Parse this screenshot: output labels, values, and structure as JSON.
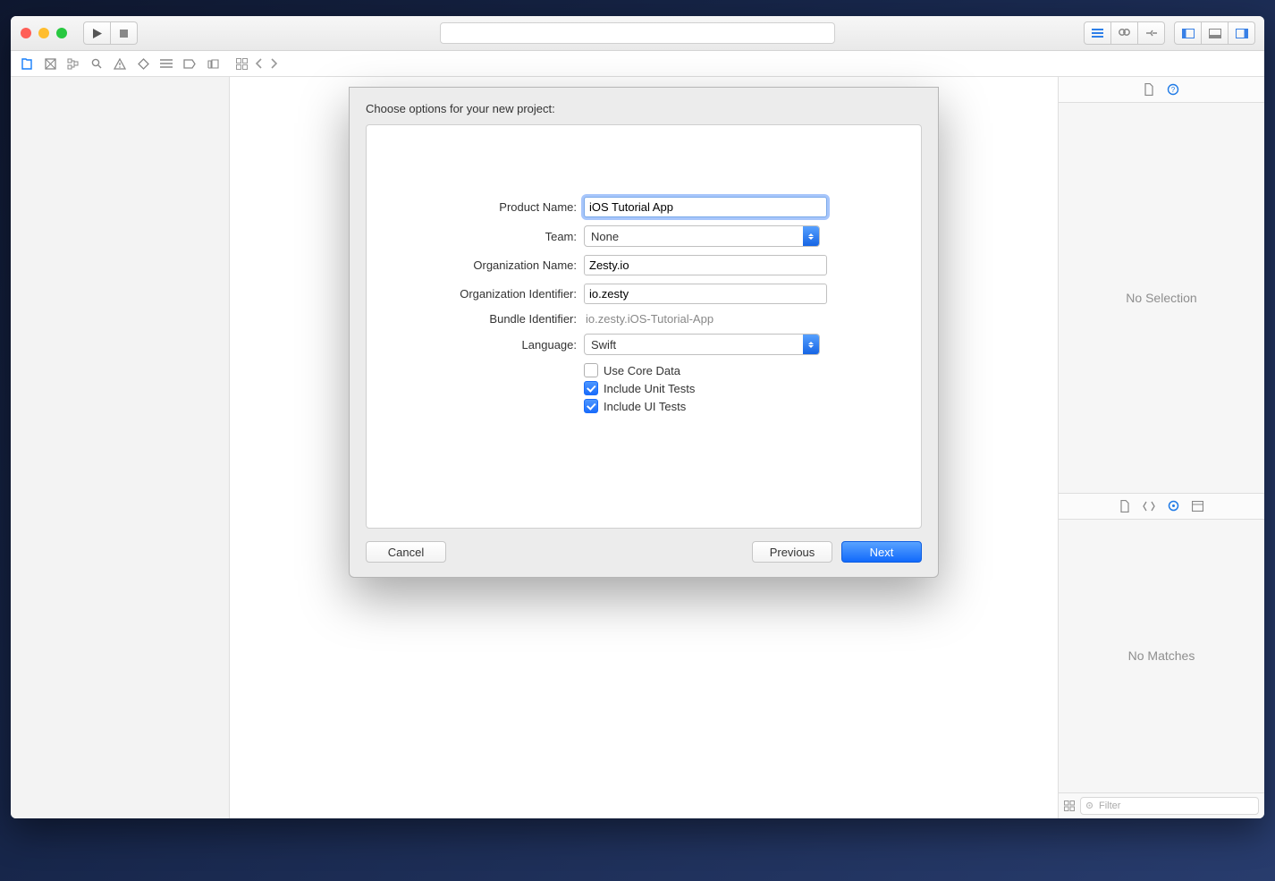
{
  "dialog": {
    "heading": "Choose options for your new project:",
    "fields": {
      "product_name": {
        "label": "Product Name:",
        "value": "iOS Tutorial App"
      },
      "team": {
        "label": "Team:",
        "value": "None"
      },
      "org_name": {
        "label": "Organization Name:",
        "value": "Zesty.io"
      },
      "org_id": {
        "label": "Organization Identifier:",
        "value": "io.zesty"
      },
      "bundle_id": {
        "label": "Bundle Identifier:",
        "value": "io.zesty.iOS-Tutorial-App"
      },
      "language": {
        "label": "Language:",
        "value": "Swift"
      },
      "core_data": {
        "label": "Use Core Data",
        "checked": false
      },
      "unit_tests": {
        "label": "Include Unit Tests",
        "checked": true
      },
      "ui_tests": {
        "label": "Include UI Tests",
        "checked": true
      }
    },
    "buttons": {
      "cancel": "Cancel",
      "previous": "Previous",
      "next": "Next"
    }
  },
  "utility": {
    "no_selection": "No Selection",
    "no_matches": "No Matches",
    "filter_placeholder": "Filter"
  }
}
